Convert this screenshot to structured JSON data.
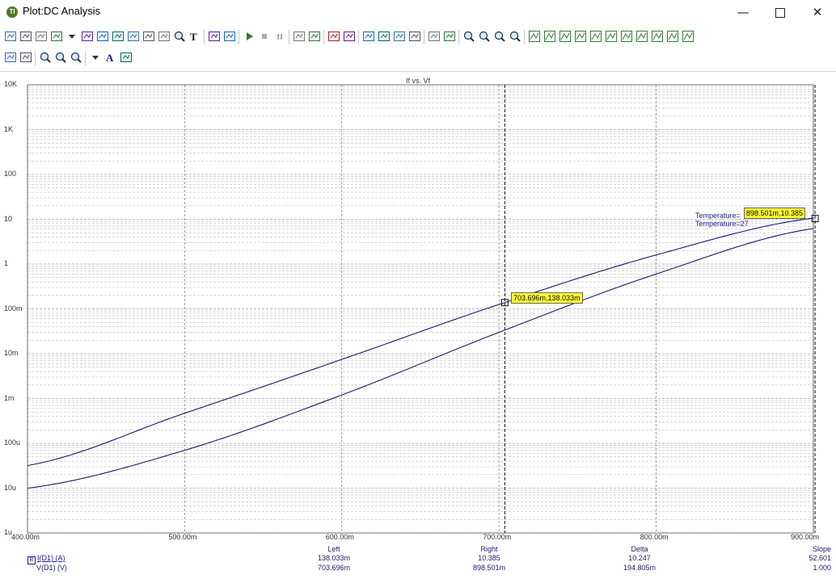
{
  "window": {
    "title": "Plot:DC Analysis",
    "icon": "plot-app-icon",
    "minimize": "—",
    "close": "✕"
  },
  "toolbar1": [
    "print-icon",
    "pointer-icon",
    "pan-hand-icon",
    "copy-icon",
    "dropdown-icon",
    "window-icon",
    "zoom-box-icon",
    "zoom-fit-icon",
    "zoom-x-icon",
    "zoom-y-icon",
    "zoom-auto-icon",
    "zoom-out-icon",
    "text-icon",
    "properties-icon",
    "export-icon",
    "run-icon",
    "stop-icon",
    "pause-icon",
    "cursor-a-icon",
    "cursor-b-icon",
    "frame-icon",
    "frame2-icon",
    "layout1-icon",
    "layout2-icon",
    "layout3-icon",
    "layout4-icon",
    "grid-h-icon",
    "grid-hv-icon",
    "zoom-in-icon",
    "zoom-out2-icon",
    "zoom-fit2-icon",
    "zoom-reset-icon",
    "marker1-icon",
    "marker2-icon",
    "marker3-icon",
    "marker4-icon",
    "marker5-icon",
    "marker6-icon",
    "marker7-icon",
    "marker8-icon",
    "marker9-icon",
    "marker10-icon",
    "marker11-icon"
  ],
  "toolbar2": [
    "fit-h-icon",
    "fit-v-icon",
    "zoom-plus-icon",
    "zoom-minus-icon",
    "zoom-1000-icon",
    "grid-dropdown-icon",
    "font-icon",
    "font-size-icon"
  ],
  "plot": {
    "title": "If vs. Vf",
    "y_ticks": [
      "10K",
      "1K",
      "100",
      "10",
      "1",
      "100m",
      "10m",
      "1m",
      "100u",
      "10u",
      "1u"
    ],
    "x_ticks": [
      "400.00m",
      "500.00m",
      "600.00m",
      "700.00m",
      "800.00m",
      "900.00m"
    ],
    "cursor_a_label": "703.696m,138.033m",
    "cursor_b_label": "898.501m,10.385",
    "temp_label_1": "Temperature=",
    "temp_label_2": "Temperature=27",
    "colors": {
      "trace": "#1a1a70",
      "grid": "#7a7a7a",
      "label_bg": "#ffff33"
    }
  },
  "chart_data": {
    "type": "line",
    "title": "If vs. Vf",
    "xlabel": "",
    "ylabel": "",
    "x_scale": "linear",
    "y_scale": "log",
    "xlim": [
      0.4,
      0.9
    ],
    "ylim": [
      1e-06,
      10000.0
    ],
    "grid": true,
    "series": [
      {
        "name": "Temperature=",
        "x": [
          0.4,
          0.5,
          0.6,
          0.7037,
          0.8,
          0.8985,
          0.9
        ],
        "y": [
          3.2e-05,
          0.00047,
          0.0075,
          0.138,
          1.6,
          10.385,
          10.6
        ]
      },
      {
        "name": "Temperature=27",
        "x": [
          0.4,
          0.5,
          0.6,
          0.7,
          0.8,
          0.9
        ],
        "y": [
          1e-05,
          7e-05,
          0.0012,
          0.03,
          0.6,
          6.2
        ]
      }
    ]
  },
  "readout": {
    "legend": [
      {
        "marker": "B",
        "text": "I(D1) (A)"
      },
      {
        "marker": "",
        "text": "V(D1) (V)"
      }
    ],
    "columns": [
      {
        "header": "Left",
        "row1": "138.033m",
        "row2": "703.696m"
      },
      {
        "header": "Right",
        "row1": "10.385",
        "row2": "898.501m"
      },
      {
        "header": "Delta",
        "row1": "10.247",
        "row2": "194.805m"
      },
      {
        "header": "Slope",
        "row1": "52.601",
        "row2": "1.000"
      }
    ]
  }
}
